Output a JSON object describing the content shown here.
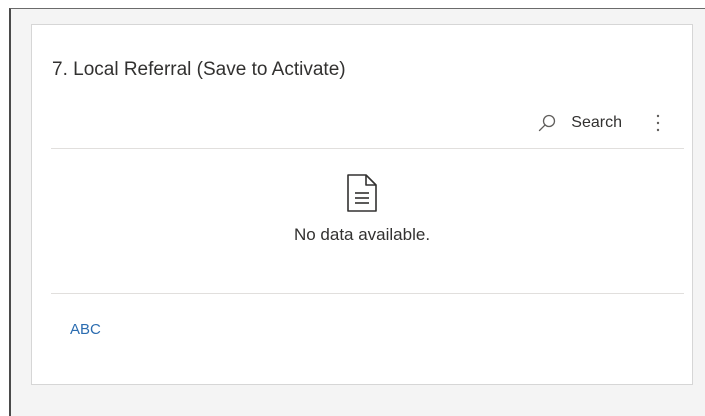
{
  "section": {
    "title": "7. Local Referral (Save to Activate)"
  },
  "toolbar": {
    "search_label": "Search",
    "search_icon": "search-icon",
    "more_icon": "more-vertical-icon"
  },
  "grid": {
    "empty_icon": "document-icon",
    "empty_message": "No data available."
  },
  "footer": {
    "link_label": "ABC"
  },
  "colors": {
    "link": "#2b6cb0",
    "text": "#323130",
    "divider": "#e1dfdd"
  }
}
